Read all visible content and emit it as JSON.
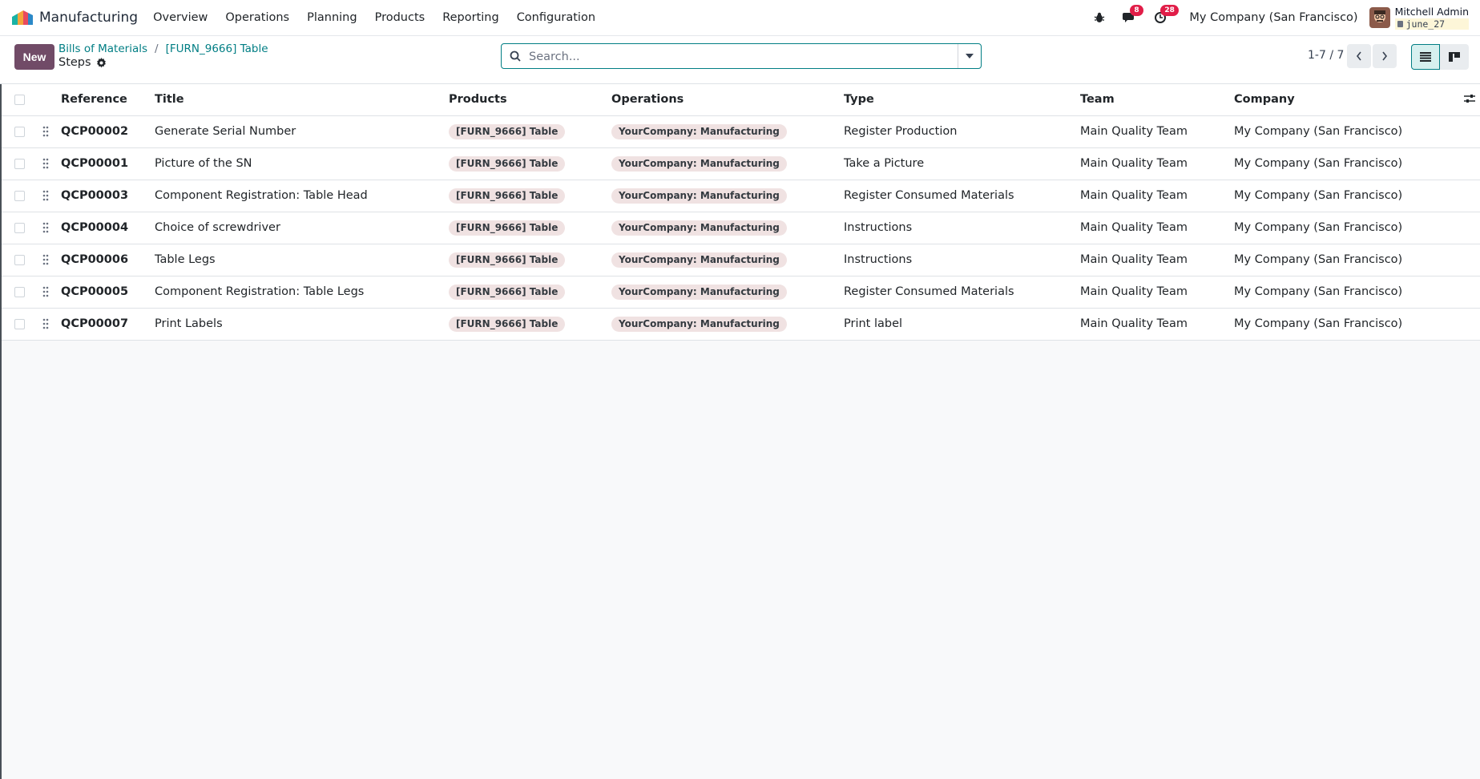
{
  "app": {
    "name": "Manufacturing",
    "menu": [
      "Overview",
      "Operations",
      "Planning",
      "Products",
      "Reporting",
      "Configuration"
    ]
  },
  "systray": {
    "messages_count": "8",
    "activities_count": "28",
    "company": "My Company (San Francisco)",
    "user_name": "Mitchell Admin",
    "database": "june_27"
  },
  "control": {
    "new_label": "New",
    "breadcrumbs": [
      "Bills of Materials",
      "[FURN_9666] Table"
    ],
    "title": "Steps",
    "search_placeholder": "Search...",
    "pager": "1-7 / 7"
  },
  "table": {
    "columns": [
      "Reference",
      "Title",
      "Products",
      "Operations",
      "Type",
      "Team",
      "Company"
    ],
    "rows": [
      {
        "reference": "QCP00002",
        "title": "Generate Serial Number",
        "product": "[FURN_9666] Table",
        "operation": "YourCompany: Manufacturing",
        "type": "Register Production",
        "team": "Main Quality Team",
        "company": "My Company (San Francisco)"
      },
      {
        "reference": "QCP00001",
        "title": "Picture of the SN",
        "product": "[FURN_9666] Table",
        "operation": "YourCompany: Manufacturing",
        "type": "Take a Picture",
        "team": "Main Quality Team",
        "company": "My Company (San Francisco)"
      },
      {
        "reference": "QCP00003",
        "title": "Component Registration: Table Head",
        "product": "[FURN_9666] Table",
        "operation": "YourCompany: Manufacturing",
        "type": "Register Consumed Materials",
        "team": "Main Quality Team",
        "company": "My Company (San Francisco)"
      },
      {
        "reference": "QCP00004",
        "title": "Choice of screwdriver",
        "product": "[FURN_9666] Table",
        "operation": "YourCompany: Manufacturing",
        "type": "Instructions",
        "team": "Main Quality Team",
        "company": "My Company (San Francisco)"
      },
      {
        "reference": "QCP00006",
        "title": "Table Legs",
        "product": "[FURN_9666] Table",
        "operation": "YourCompany: Manufacturing",
        "type": "Instructions",
        "team": "Main Quality Team",
        "company": "My Company (San Francisco)"
      },
      {
        "reference": "QCP00005",
        "title": "Component Registration: Table Legs",
        "product": "[FURN_9666] Table",
        "operation": "YourCompany: Manufacturing",
        "type": "Register Consumed Materials",
        "team": "Main Quality Team",
        "company": "My Company (San Francisco)"
      },
      {
        "reference": "QCP00007",
        "title": "Print Labels",
        "product": "[FURN_9666] Table",
        "operation": "YourCompany: Manufacturing",
        "type": "Print label",
        "team": "Main Quality Team",
        "company": "My Company (San Francisco)"
      }
    ]
  },
  "colors": {
    "brand": "#714b67",
    "accent": "#017e84",
    "badge": "#e11d48"
  }
}
